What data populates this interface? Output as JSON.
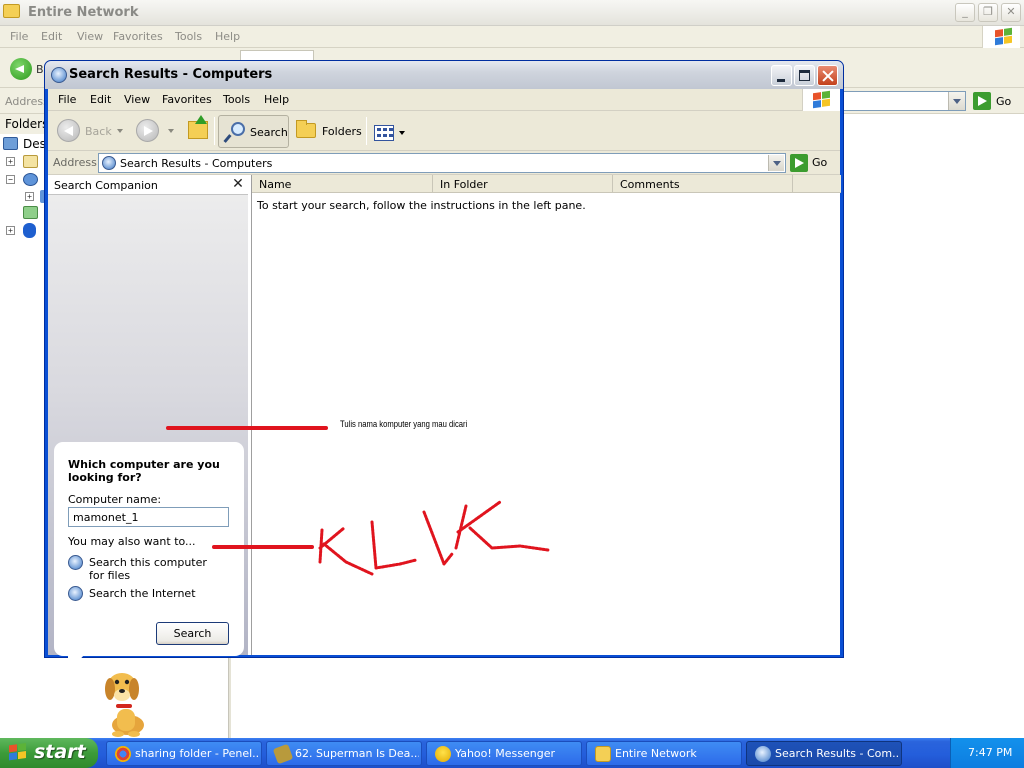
{
  "background_window": {
    "title": "Entire Network",
    "menu": [
      "File",
      "Edit",
      "View",
      "Favorites",
      "Tools",
      "Help"
    ],
    "back_label": "B",
    "address_label": "Address",
    "go_label": "Go",
    "folders_label": "Folders",
    "tree": [
      {
        "expander": "",
        "label": "Desk"
      },
      {
        "expander": "+",
        "label": ""
      },
      {
        "expander": "−",
        "label": ""
      },
      {
        "expander": "+",
        "label": ""
      },
      {
        "expander": "",
        "label": ""
      },
      {
        "expander": "+",
        "label": ""
      }
    ]
  },
  "window": {
    "title": "Search Results - Computers",
    "menu": [
      "File",
      "Edit",
      "View",
      "Favorites",
      "Tools",
      "Help"
    ],
    "toolbar": {
      "back": "Back",
      "search": "Search",
      "folders": "Folders"
    },
    "address": {
      "label": "Address",
      "value": "Search Results - Computers",
      "go": "Go"
    }
  },
  "companion": {
    "title": "Search Companion",
    "close_glyph": "✕",
    "question": "Which computer are you looking for?",
    "computer_name_label": "Computer name:",
    "computer_name_value": "mamonet_1",
    "also_text": "You may also want to...",
    "options": [
      "Search this computer for files",
      "Search the Internet"
    ],
    "search_button": "Search"
  },
  "results": {
    "columns": [
      "Name",
      "In Folder",
      "Comments"
    ],
    "message": "To start your search, follow the instructions in the left pane."
  },
  "annotations": {
    "note": "Tulis nama komputer yang mau dicari",
    "klik": "KLIK",
    "color": "#e0141e"
  },
  "taskbar": {
    "start": "start",
    "tasks": [
      {
        "label": "sharing folder - Penel...",
        "icon": "chrome-icon",
        "active": false
      },
      {
        "label": "62. Superman Is Dea...",
        "icon": "winamp-icon",
        "active": false
      },
      {
        "label": "Yahoo! Messenger",
        "icon": "yahoo-messenger-icon",
        "active": false
      },
      {
        "label": "Entire Network",
        "icon": "folder-icon",
        "active": false
      },
      {
        "label": "Search Results - Com...",
        "icon": "search-results-icon",
        "active": true
      }
    ],
    "clock": "7:47 PM"
  }
}
